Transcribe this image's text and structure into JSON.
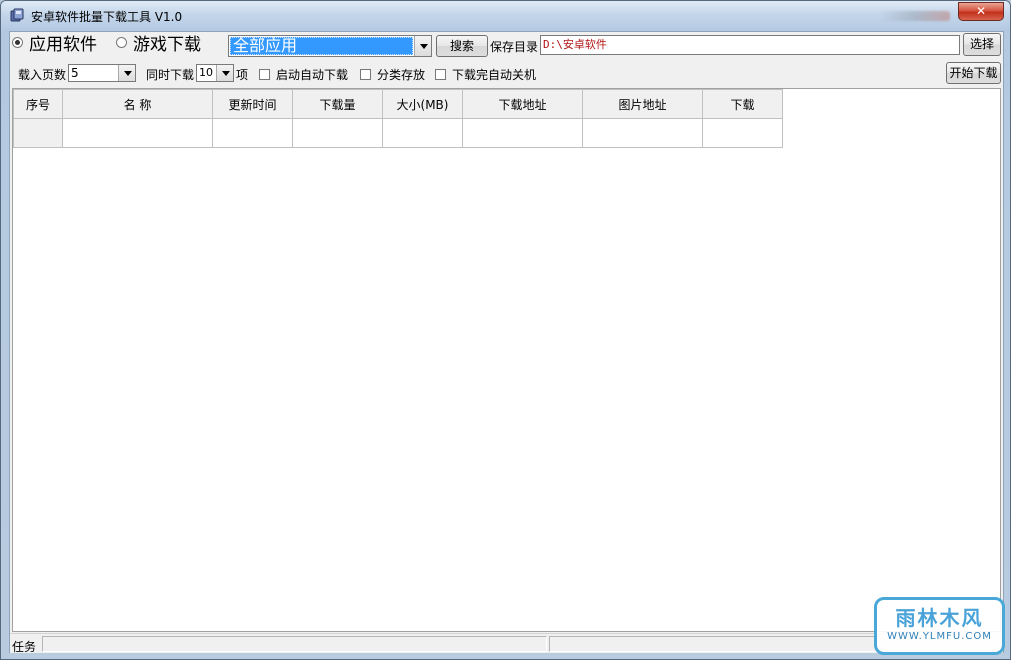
{
  "window": {
    "title": "安卓软件批量下载工具 V1.0",
    "close_label": "✕"
  },
  "toolbar": {
    "radio_apps": "应用软件",
    "radio_games": "游戏下载",
    "category_value": "全部应用",
    "search_label": "搜索",
    "save_dir_label": "保存目录",
    "save_dir_value": "D:\\安卓软件",
    "choose_label": "选择",
    "pages_label": "载入页数",
    "pages_value": "5",
    "concurrent_label": "同时下载",
    "concurrent_value": "10",
    "concurrent_unit": "项",
    "auto_start_label": "启动自动下载",
    "classify_label": "分类存放",
    "shutdown_label": "下载完自动关机",
    "start_label": "开始下载"
  },
  "grid": {
    "columns": [
      "序号",
      "名 称",
      "更新时间",
      "下载量",
      "大小(MB)",
      "下载地址",
      "图片地址",
      "下载"
    ]
  },
  "statusbar": {
    "task_label": "任务"
  },
  "watermark": {
    "title": "雨林木风",
    "url": "WWW.YLMFU.COM"
  },
  "colors": {
    "accent_selection": "#3399ff",
    "path_text": "#b21515",
    "close_button": "#c9402a"
  }
}
